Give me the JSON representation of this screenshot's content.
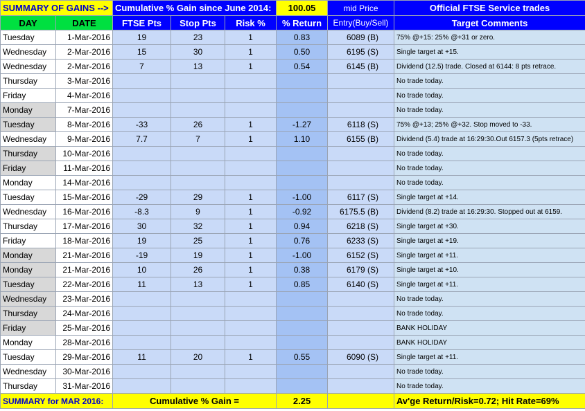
{
  "header": {
    "summary_label": "SUMMARY OF GAINS -->",
    "cumulative_label": "Cumulative % Gain since June 2014:",
    "cumulative_value": "100.05",
    "mid_price_label": "mid Price",
    "service_label": "Official FTSE Service trades"
  },
  "columns": [
    "DAY",
    "DATE",
    "FTSE Pts",
    "Stop Pts",
    "Risk %",
    "% Return",
    "Entry(Buy/Sell)",
    "Target Comments"
  ],
  "rows": [
    {
      "day": "Tuesday",
      "date": "1-Mar-2016",
      "pts": "19",
      "stop": "23",
      "risk": "1",
      "ret": "0.83",
      "entry": "6089 (B)",
      "comment": "75% @+15: 25% @+31 or zero.",
      "shade": "w"
    },
    {
      "day": "Wednesday",
      "date": "2-Mar-2016",
      "pts": "15",
      "stop": "30",
      "risk": "1",
      "ret": "0.50",
      "entry": "6195 (S)",
      "comment": "Single target at +15.",
      "shade": "w"
    },
    {
      "day": "Wednesday",
      "date": "2-Mar-2016",
      "pts": "7",
      "stop": "13",
      "risk": "1",
      "ret": "0.54",
      "entry": "6145 (B)",
      "comment": "Dividend (12.5) trade.  Closed at 6144: 8 pts retrace.",
      "shade": "w"
    },
    {
      "day": "Thursday",
      "date": "3-Mar-2016",
      "pts": "",
      "stop": "",
      "risk": "",
      "ret": "",
      "entry": "",
      "comment": "No trade today.",
      "shade": "w"
    },
    {
      "day": "Friday",
      "date": "4-Mar-2016",
      "pts": "",
      "stop": "",
      "risk": "",
      "ret": "",
      "entry": "",
      "comment": "No trade today.",
      "shade": "w"
    },
    {
      "day": "Monday",
      "date": "7-Mar-2016",
      "pts": "",
      "stop": "",
      "risk": "",
      "ret": "",
      "entry": "",
      "comment": "No trade today.",
      "shade": "g"
    },
    {
      "day": "Tuesday",
      "date": "8-Mar-2016",
      "pts": "-33",
      "stop": "26",
      "risk": "1",
      "ret": "-1.27",
      "entry": "6118 (S)",
      "comment": "75% @+13; 25% @+32.  Stop moved to -33.",
      "shade": "g"
    },
    {
      "day": "Wednesday",
      "date": "9-Mar-2016",
      "pts": "7.7",
      "stop": "7",
      "risk": "1",
      "ret": "1.10",
      "entry": "6155 (B)",
      "comment": "Dividend (5.4) trade at 16:29:30.Out 6157.3 (5pts retrace)",
      "shade": "w"
    },
    {
      "day": "Thursday",
      "date": "10-Mar-2016",
      "pts": "",
      "stop": "",
      "risk": "",
      "ret": "",
      "entry": "",
      "comment": "No trade today.",
      "shade": "g"
    },
    {
      "day": "Friday",
      "date": "11-Mar-2016",
      "pts": "",
      "stop": "",
      "risk": "",
      "ret": "",
      "entry": "",
      "comment": "No trade today.",
      "shade": "g"
    },
    {
      "day": "Monday",
      "date": "14-Mar-2016",
      "pts": "",
      "stop": "",
      "risk": "",
      "ret": "",
      "entry": "",
      "comment": "No trade today.",
      "shade": "w"
    },
    {
      "day": "Tuesday",
      "date": "15-Mar-2016",
      "pts": "-29",
      "stop": "29",
      "risk": "1",
      "ret": "-1.00",
      "entry": "6117 (S)",
      "comment": "Single target at +14.",
      "shade": "w"
    },
    {
      "day": "Wednesday",
      "date": "16-Mar-2016",
      "pts": "-8.3",
      "stop": "9",
      "risk": "1",
      "ret": "-0.92",
      "entry": "6175.5 (B)",
      "comment": "Dividend (8.2) trade at 16:29:30.  Stopped out at 6159.",
      "shade": "w"
    },
    {
      "day": "Thursday",
      "date": "17-Mar-2016",
      "pts": "30",
      "stop": "32",
      "risk": "1",
      "ret": "0.94",
      "entry": "6218 (S)",
      "comment": "Single target at +30.",
      "shade": "w"
    },
    {
      "day": "Friday",
      "date": "18-Mar-2016",
      "pts": "19",
      "stop": "25",
      "risk": "1",
      "ret": "0.76",
      "entry": "6233 (S)",
      "comment": "Single target at +19.",
      "shade": "w"
    },
    {
      "day": "Monday",
      "date": "21-Mar-2016",
      "pts": "-19",
      "stop": "19",
      "risk": "1",
      "ret": "-1.00",
      "entry": "6152 (S)",
      "comment": "Single target at +11.",
      "shade": "g"
    },
    {
      "day": "Monday",
      "date": "21-Mar-2016",
      "pts": "10",
      "stop": "26",
      "risk": "1",
      "ret": "0.38",
      "entry": "6179 (S)",
      "comment": "Single target at +10.",
      "shade": "g"
    },
    {
      "day": "Tuesday",
      "date": "22-Mar-2016",
      "pts": "11",
      "stop": "13",
      "risk": "1",
      "ret": "0.85",
      "entry": "6140 (S)",
      "comment": "Single target at +11.",
      "shade": "g"
    },
    {
      "day": "Wednesday",
      "date": "23-Mar-2016",
      "pts": "",
      "stop": "",
      "risk": "",
      "ret": "",
      "entry": "",
      "comment": "No trade today.",
      "shade": "g"
    },
    {
      "day": "Thursday",
      "date": "24-Mar-2016",
      "pts": "",
      "stop": "",
      "risk": "",
      "ret": "",
      "entry": "",
      "comment": "No trade today.",
      "shade": "g"
    },
    {
      "day": "Friday",
      "date": "25-Mar-2016",
      "pts": "",
      "stop": "",
      "risk": "",
      "ret": "",
      "entry": "",
      "comment": "BANK HOLIDAY",
      "shade": "g"
    },
    {
      "day": "Monday",
      "date": "28-Mar-2016",
      "pts": "",
      "stop": "",
      "risk": "",
      "ret": "",
      "entry": "",
      "comment": "BANK HOLIDAY",
      "shade": "w"
    },
    {
      "day": "Tuesday",
      "date": "29-Mar-2016",
      "pts": "11",
      "stop": "20",
      "risk": "1",
      "ret": "0.55",
      "entry": "6090 (S)",
      "comment": "Single target at +11.",
      "shade": "w"
    },
    {
      "day": "Wednesday",
      "date": "30-Mar-2016",
      "pts": "",
      "stop": "",
      "risk": "",
      "ret": "",
      "entry": "",
      "comment": "No trade today.",
      "shade": "w"
    },
    {
      "day": "Thursday",
      "date": "31-Mar-2016",
      "pts": "",
      "stop": "",
      "risk": "",
      "ret": "",
      "entry": "",
      "comment": "No trade today.",
      "shade": "w"
    }
  ],
  "summary": {
    "label": "SUMMARY for MAR 2016:",
    "cumulative_label": "Cumulative % Gain =",
    "cumulative_value": "2.25",
    "stats": "Av'ge Return/Risk=0.72;  Hit Rate=69%"
  }
}
